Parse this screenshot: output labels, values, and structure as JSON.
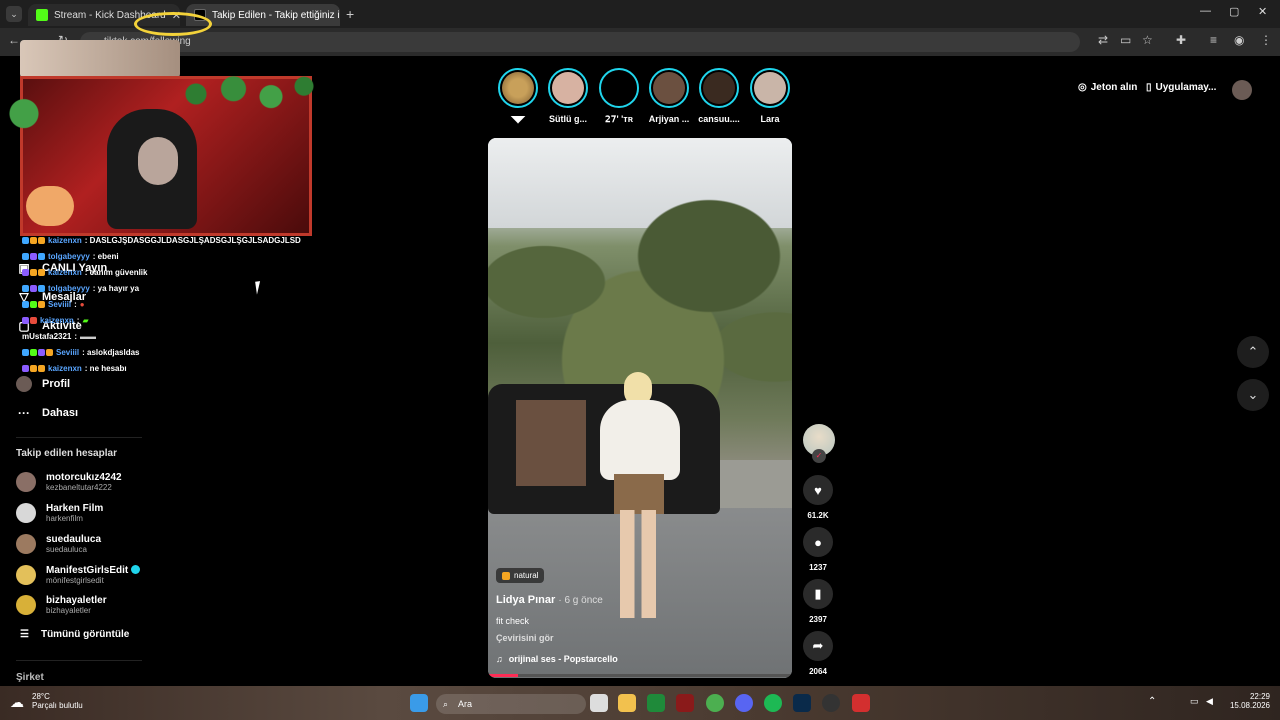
{
  "browser": {
    "tabs": [
      {
        "title": "Stream - Kick Dashboard",
        "favicon_color": "#53fc18"
      },
      {
        "title": "Takip Edilen - Takip ettiğiniz içe",
        "favicon_color": "#000000"
      }
    ],
    "new_tab": "+",
    "url": "tiktok.com/following",
    "window_controls": [
      "—",
      "▢",
      "✕"
    ]
  },
  "overlay": {
    "chat": [
      {
        "user": "kaizenxn",
        "message": ": DASLGJŞDASGGJLDASGJLŞADSGJLŞGJLSADGJLSD"
      },
      {
        "user": "tolgabeyyy",
        "message": ": ebeni"
      },
      {
        "user": "kaizenxn",
        "message": ": canım güvenlik"
      },
      {
        "user": "tolgabeyyy",
        "message": ": ya hayır ya"
      },
      {
        "user": "Seviiil",
        "message": ":"
      },
      {
        "user": "kaizenxn",
        "message": ":"
      },
      {
        "user": "mUstafa2321",
        "message": ":"
      },
      {
        "user": "Seviiil",
        "message": ": aslokdjasldas"
      },
      {
        "user": "kaizenxn",
        "message": ": ne hesabı"
      }
    ]
  },
  "sidebar": {
    "nav": [
      {
        "label": "CANLI Yayın",
        "icon": "live-icon"
      },
      {
        "label": "Mesajlar",
        "icon": "messages-icon"
      },
      {
        "label": "Aktivite",
        "icon": "activity-icon"
      },
      {
        "label": "Profil",
        "icon": "profile-icon"
      },
      {
        "label": "Dahası",
        "icon": "more-icon"
      }
    ],
    "followed_title": "Takip edilen hesaplar",
    "followed": [
      {
        "name": "motorcukız4242",
        "handle": "kezbaneltutar4222",
        "color": "#8a6f66"
      },
      {
        "name": "Harken Film",
        "handle": "harkenfilm",
        "color": "#d8d8d8"
      },
      {
        "name": "suedauluca",
        "handle": "suedauluca",
        "color": "#9c7a60"
      },
      {
        "name": "ManifestGirlsEdit",
        "handle": "mönifestgirlsedit",
        "color": "#e3c05a",
        "verified": true
      },
      {
        "name": "bizhayaletler",
        "handle": "bizhayaletler",
        "color": "#d8b038"
      }
    ],
    "see_all": "Tümünü görüntüle",
    "company": "Şirket"
  },
  "stories": [
    {
      "label": "",
      "color": "#c8a05a"
    },
    {
      "label": "Sütlü g...",
      "color": "#d7b2a2"
    },
    {
      "label": "𝟤𝟩' 'ᴛʀ",
      "color": "#000000"
    },
    {
      "label": "Arjiyan ...",
      "color": "#6b5040"
    },
    {
      "label": "cansuu....",
      "color": "#3a2a20"
    },
    {
      "label": "Lara",
      "color": "#c9b5a8"
    }
  ],
  "video": {
    "tag": "natural",
    "author": "Lidya Pınar",
    "time_ago": "· 6 g önce",
    "caption": "fit check",
    "translate": "Çevirisini gör",
    "music": "orijinal ses - Popstarcello",
    "progress": 0.1
  },
  "actions": {
    "likes": "61.2K",
    "comments": "1237",
    "saves": "2397",
    "shares": "2064"
  },
  "header": {
    "coins": "Jeton alın",
    "app": "Uygulamay..."
  },
  "taskbar": {
    "temp": "28°C",
    "weather": "Parçalı bulutlu",
    "search": "Ara",
    "time": "22:29",
    "date": "15.08.2026"
  }
}
